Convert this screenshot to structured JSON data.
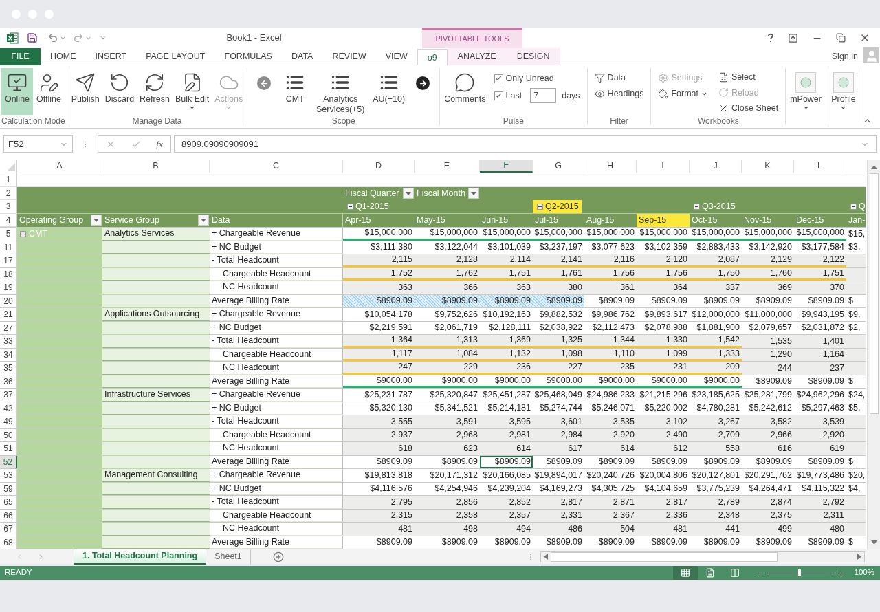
{
  "window": {
    "title": "Book1 - Excel",
    "context_group": "PIVOTTABLE TOOLS",
    "sign_in": "Sign in"
  },
  "ribbon_tabs": [
    {
      "label": "FILE",
      "kind": "file",
      "selected": false
    },
    {
      "label": "HOME",
      "kind": "standard",
      "selected": false
    },
    {
      "label": "INSERT",
      "kind": "standard",
      "selected": false
    },
    {
      "label": "PAGE LAYOUT",
      "kind": "standard",
      "selected": false
    },
    {
      "label": "FORMULAS",
      "kind": "standard",
      "selected": false
    },
    {
      "label": "DATA",
      "kind": "standard",
      "selected": false
    },
    {
      "label": "REVIEW",
      "kind": "standard",
      "selected": false
    },
    {
      "label": "VIEW",
      "kind": "standard",
      "selected": false
    },
    {
      "label": "o9",
      "kind": "standard",
      "selected": true
    },
    {
      "label": "ANALYZE",
      "kind": "contextual",
      "selected": false
    },
    {
      "label": "DESIGN",
      "kind": "contextual",
      "selected": false
    }
  ],
  "ribbon": {
    "groups": [
      {
        "label": "Calculation Mode",
        "items": [
          {
            "kind": "large",
            "label": "Online",
            "selected": true,
            "disabled": false,
            "dropdown": false
          },
          {
            "kind": "large",
            "label": "Offline",
            "selected": false,
            "disabled": false,
            "dropdown": false
          }
        ]
      },
      {
        "label": "Manage Data",
        "items": [
          {
            "kind": "large",
            "label": "Publish",
            "selected": false,
            "disabled": false,
            "dropdown": false
          },
          {
            "kind": "large",
            "label": "Discard",
            "selected": false,
            "disabled": false,
            "dropdown": false
          },
          {
            "kind": "large",
            "label": "Refresh",
            "selected": false,
            "disabled": false,
            "dropdown": false
          },
          {
            "kind": "large",
            "label": "Bulk Edit",
            "selected": false,
            "disabled": false,
            "dropdown": true
          },
          {
            "kind": "large",
            "label": "Actions",
            "selected": false,
            "disabled": true,
            "dropdown": true
          }
        ]
      },
      {
        "label": "Scope",
        "items": [
          {
            "kind": "nav",
            "disabled": true
          },
          {
            "kind": "large",
            "label": "CMT",
            "selected": false,
            "disabled": false,
            "dropdown": false
          },
          {
            "kind": "large",
            "label": "Analytics Services(+5)",
            "selected": false,
            "disabled": false,
            "dropdown": false
          },
          {
            "kind": "large",
            "label": "AU(+10)",
            "selected": false,
            "disabled": false,
            "dropdown": false
          },
          {
            "kind": "nav",
            "disabled": false
          }
        ]
      },
      {
        "label": "Pulse",
        "items": [
          {
            "kind": "large",
            "label": "Comments",
            "selected": false,
            "disabled": false,
            "dropdown": false
          },
          {
            "kind": "stack",
            "items": [
              {
                "kind": "check",
                "label": "Only Unread",
                "checked": true
              },
              {
                "kind": "check",
                "label": "Last",
                "checked": true,
                "input_value": "7",
                "unit": "days"
              }
            ]
          }
        ]
      },
      {
        "label": "Filter",
        "items": [
          {
            "kind": "stack",
            "items": [
              {
                "kind": "small",
                "label": "Data",
                "disabled": false,
                "dropdown": false
              },
              {
                "kind": "small",
                "label": "Headings",
                "disabled": false,
                "dropdown": false
              }
            ]
          }
        ]
      },
      {
        "label": "Workbooks",
        "items": [
          {
            "kind": "stack",
            "items": [
              {
                "kind": "small",
                "label": "Settings",
                "disabled": true,
                "dropdown": false
              },
              {
                "kind": "small",
                "label": "Format",
                "disabled": false,
                "dropdown": true
              }
            ]
          },
          {
            "kind": "stack",
            "items": [
              {
                "kind": "small",
                "label": "Select",
                "disabled": false,
                "dropdown": false
              },
              {
                "kind": "small",
                "label": "Reload",
                "disabled": true,
                "dropdown": false
              },
              {
                "kind": "small",
                "label": "Close Sheet",
                "disabled": false,
                "dropdown": false
              }
            ]
          }
        ]
      },
      {
        "items": [
          {
            "kind": "large",
            "label": "mPower",
            "selected": false,
            "disabled": false,
            "dropdown": true
          }
        ]
      },
      {
        "items": [
          {
            "kind": "large",
            "label": "Profile",
            "selected": false,
            "disabled": false,
            "dropdown": true
          }
        ]
      }
    ]
  },
  "formula_bar": {
    "name_box": "F52",
    "function_label": "fx",
    "formula": "8909.09090909091"
  },
  "grid": {
    "columns": [
      {
        "letter": "A",
        "selected": false
      },
      {
        "letter": "B",
        "selected": false
      },
      {
        "letter": "C",
        "selected": false
      },
      {
        "letter": "D",
        "selected": false
      },
      {
        "letter": "E",
        "selected": false
      },
      {
        "letter": "F",
        "selected": true
      },
      {
        "letter": "G",
        "selected": false
      },
      {
        "letter": "H",
        "selected": false
      },
      {
        "letter": "I",
        "selected": false
      },
      {
        "letter": "J",
        "selected": false
      },
      {
        "letter": "K",
        "selected": false
      },
      {
        "letter": "L",
        "selected": false
      }
    ],
    "header_row_numbers": [
      "1",
      "2",
      "3",
      "4"
    ],
    "column_fields": [
      {
        "label": "Fiscal Quarter",
        "filter": true
      },
      {
        "label": "Fiscal Month",
        "filter": true
      }
    ],
    "quarters": [
      {
        "label": "Q1-2015",
        "expanded": true,
        "selected": false,
        "months": [
          {
            "label": "Apr-15",
            "selected": false
          },
          {
            "label": "May-15",
            "selected": false
          },
          {
            "label": "Jun-15",
            "selected": false
          }
        ]
      },
      {
        "label": "Q2-2015",
        "expanded": true,
        "selected": true,
        "months": [
          {
            "label": "Jul-15",
            "selected": false
          },
          {
            "label": "Aug-15",
            "selected": false
          },
          {
            "label": "Sep-15",
            "selected": true
          }
        ]
      },
      {
        "label": "Q3-2015",
        "expanded": true,
        "selected": false,
        "months": [
          {
            "label": "Oct-15",
            "selected": false
          },
          {
            "label": "Nov-15",
            "selected": false
          },
          {
            "label": "Dec-15",
            "selected": false
          }
        ]
      },
      {
        "label": "Q",
        "expanded": true,
        "selected": false,
        "months": [
          {
            "label": "Jan-",
            "selected": false
          }
        ]
      }
    ],
    "row_fields": [
      {
        "label": "Operating Group",
        "filter": true
      },
      {
        "label": "Service Group",
        "filter": true
      },
      {
        "label": "Data",
        "filter": false
      }
    ],
    "rows": [
      {
        "number": "5",
        "selected": false,
        "kind": "currency",
        "operating_group": {
          "label": "CMT",
          "expanded": true
        },
        "service_group": "Analytics Services",
        "measure": "+ Chargeable Revenue",
        "values": [
          {
            "text": "$15,000,000",
            "color": "#22b36a"
          },
          {
            "text": "$15,000,000",
            "color": "#22b36a"
          },
          {
            "text": "$15,000,000",
            "color": "#22b36a"
          },
          {
            "text": "$15,000,000",
            "color": "#22b36a"
          },
          {
            "text": "$15,000,000",
            "color": "#22b36a"
          },
          {
            "text": "$15,000,000",
            "color": "#22b36a"
          },
          {
            "text": "$15,000,000",
            "color": "#22b36a"
          },
          {
            "text": "$15,000,000",
            "color": "#22b36a"
          },
          {
            "text": "$15,000,000",
            "color": "#22b36a"
          },
          "$15,"
        ]
      },
      {
        "number": "11",
        "selected": false,
        "kind": "currency",
        "measure": "+ NC Budget",
        "values": [
          "$3,111,380",
          "$3,122,044",
          "$3,101,039",
          "$3,237,197",
          "$3,077,623",
          "$3,102,359",
          "$2,883,433",
          "$3,142,920",
          "$3,177,584",
          "$3,"
        ]
      },
      {
        "number": "17",
        "selected": false,
        "kind": "headcount",
        "measure": "- Total Headcount",
        "values": [
          {
            "text": "2,115",
            "color": "#f7c42c"
          },
          {
            "text": "2,128",
            "color": "#f7c42c"
          },
          {
            "text": "2,114",
            "color": "#f7c42c"
          },
          {
            "text": "2,141",
            "color": "#f7c42c"
          },
          {
            "text": "2,116",
            "color": "#f7c42c"
          },
          {
            "text": "2,120",
            "color": "#f7c42c"
          },
          {
            "text": "2,087",
            "color": "#f7c42c"
          },
          {
            "text": "2,129",
            "color": "#f7c42c"
          },
          {
            "text": "2,122",
            "color": "#f7c42c"
          }
        ]
      },
      {
        "number": "18",
        "selected": false,
        "kind": "headcount-detail",
        "measure": "Chargeable Headcount",
        "values": [
          {
            "text": "1,752",
            "color": "#f7c42c"
          },
          {
            "text": "1,762",
            "color": "#f7c42c"
          },
          {
            "text": "1,751",
            "color": "#f7c42c"
          },
          {
            "text": "1,761",
            "color": "#f7c42c"
          },
          {
            "text": "1,756",
            "color": "#f7c42c"
          },
          {
            "text": "1,756",
            "color": "#f7c42c"
          },
          {
            "text": "1,750",
            "color": "#f7c42c"
          },
          {
            "text": "1,760",
            "color": "#f7c42c"
          },
          {
            "text": "1,751",
            "color": "#f7c42c"
          }
        ]
      },
      {
        "number": "19",
        "selected": false,
        "kind": "headcount-detail",
        "measure": "NC Headcount",
        "values": [
          "363",
          "366",
          "363",
          "380",
          "361",
          "364",
          "337",
          "369",
          "370"
        ]
      },
      {
        "number": "20",
        "selected": false,
        "kind": "currency",
        "measure": "Average Billing Rate",
        "values": [
          {
            "text": "$8909.09",
            "selected": true
          },
          {
            "text": "$8909.09",
            "selected": true
          },
          {
            "text": "$8909.09",
            "selected": true
          },
          {
            "text": "$8909.09",
            "selected": true
          },
          "$8909.09",
          "$8909.09",
          "$8909.09",
          "$8909.09",
          "$8909.09",
          "$"
        ]
      },
      {
        "number": "21",
        "selected": false,
        "kind": "currency",
        "service_group": "Applications Outsourcing",
        "measure": "+ Chargeable Revenue",
        "values": [
          "$10,054,178",
          "$9,752,626",
          "$10,192,163",
          "$9,882,532",
          "$9,986,762",
          "$9,893,617",
          "$12,000,000",
          "$11,000,000",
          "$9,943,195",
          "$9,"
        ]
      },
      {
        "number": "27",
        "selected": false,
        "kind": "currency",
        "measure": "+ NC Budget",
        "values": [
          "$2,219,591",
          "$2,061,719",
          "$2,128,111",
          "$2,038,922",
          "$2,112,473",
          "$2,078,988",
          "$1,881,900",
          "$2,079,657",
          "$2,031,872",
          "$2,"
        ]
      },
      {
        "number": "33",
        "selected": false,
        "kind": "headcount",
        "measure": "- Total Headcount",
        "values": [
          {
            "text": "1,364",
            "color": "#f7c42c"
          },
          {
            "text": "1,313",
            "color": "#f7c42c"
          },
          {
            "text": "1,369",
            "color": "#f7c42c"
          },
          {
            "text": "1,325",
            "color": "#f7c42c"
          },
          {
            "text": "1,344",
            "color": "#f7c42c"
          },
          {
            "text": "1,330",
            "color": "#f7c42c"
          },
          {
            "text": "1,542",
            "color": "#f7c42c"
          },
          "1,535",
          "1,401"
        ]
      },
      {
        "number": "34",
        "selected": false,
        "kind": "headcount-detail",
        "measure": "Chargeable Headcount",
        "values": [
          {
            "text": "1,117",
            "color": "#f7c42c"
          },
          {
            "text": "1,084",
            "color": "#f7c42c"
          },
          {
            "text": "1,132",
            "color": "#f7c42c"
          },
          {
            "text": "1,098",
            "color": "#f7c42c"
          },
          {
            "text": "1,110",
            "color": "#f7c42c"
          },
          {
            "text": "1,099",
            "color": "#f7c42c"
          },
          {
            "text": "1,333",
            "color": "#f7c42c"
          },
          "1,290",
          "1,164"
        ]
      },
      {
        "number": "35",
        "selected": false,
        "kind": "headcount-detail",
        "measure": "NC Headcount",
        "values": [
          {
            "text": "247",
            "color": "#f7c42c"
          },
          {
            "text": "229",
            "color": "#f7c42c"
          },
          {
            "text": "236",
            "color": "#f7c42c"
          },
          {
            "text": "227",
            "color": "#f7c42c"
          },
          {
            "text": "235",
            "color": "#f7c42c"
          },
          {
            "text": "231",
            "color": "#f7c42c"
          },
          {
            "text": "209",
            "color": "#f7c42c"
          },
          "244",
          "237"
        ]
      },
      {
        "number": "36",
        "selected": false,
        "kind": "currency",
        "measure": "Average Billing Rate",
        "values": [
          {
            "text": "$9000.00",
            "color": "#22b36a"
          },
          {
            "text": "$9000.00",
            "color": "#22b36a"
          },
          {
            "text": "$9000.00",
            "color": "#22b36a"
          },
          {
            "text": "$9000.00",
            "color": "#22b36a"
          },
          {
            "text": "$9000.00",
            "color": "#22b36a"
          },
          {
            "text": "$9000.00",
            "color": "#22b36a"
          },
          {
            "text": "$9000.00",
            "color": "#22b36a"
          },
          "$8909.09",
          "$8909.09",
          "$"
        ]
      },
      {
        "number": "37",
        "selected": false,
        "kind": "currency",
        "service_group": "Infrastructure Services",
        "measure": "+ Chargeable Revenue",
        "values": [
          "$25,231,787",
          "$25,320,847",
          "$25,451,287",
          "$25,468,049",
          "$24,986,233",
          "$21,215,296",
          "$23,185,625",
          "$25,281,799",
          "$24,962,296",
          "$24,"
        ]
      },
      {
        "number": "43",
        "selected": false,
        "kind": "currency",
        "measure": "+ NC Budget",
        "values": [
          "$5,320,130",
          "$5,341,521",
          "$5,214,181",
          "$5,274,744",
          "$5,246,071",
          "$5,220,002",
          "$4,780,281",
          "$5,242,612",
          "$5,297,463",
          "$5,"
        ]
      },
      {
        "number": "49",
        "selected": false,
        "kind": "headcount",
        "measure": "- Total Headcount",
        "values": [
          "3,555",
          "3,591",
          "3,595",
          "3,601",
          "3,535",
          "3,102",
          "3,267",
          "3,582",
          "3,539"
        ]
      },
      {
        "number": "50",
        "selected": false,
        "kind": "headcount-detail",
        "measure": "Chargeable Headcount",
        "values": [
          "2,937",
          "2,968",
          "2,981",
          "2,984",
          "2,920",
          "2,490",
          "2,709",
          "2,966",
          "2,920"
        ]
      },
      {
        "number": "51",
        "selected": false,
        "kind": "headcount-detail",
        "measure": "NC Headcount",
        "values": [
          "618",
          "623",
          "614",
          "617",
          "614",
          "612",
          "558",
          "616",
          "619"
        ]
      },
      {
        "number": "52",
        "selected": true,
        "kind": "currency",
        "measure": "Average Billing Rate",
        "values": [
          "$8909.09",
          "$8909.09",
          "$8909.09",
          "$8909.09",
          "$8909.09",
          "$8909.09",
          "$8909.09",
          "$8909.09",
          "$8909.09",
          "$"
        ]
      },
      {
        "number": "53",
        "selected": false,
        "kind": "currency",
        "service_group": "Management Consulting",
        "measure": "+ Chargeable Revenue",
        "values": [
          "$19,813,818",
          "$20,171,312",
          "$20,166,085",
          "$19,894,017",
          "$20,240,726",
          "$20,004,806",
          "$20,127,801",
          "$20,291,762",
          "$19,773,486",
          "$20,"
        ]
      },
      {
        "number": "59",
        "selected": false,
        "kind": "currency",
        "measure": "+ NC Budget",
        "values": [
          "$4,116,576",
          "$4,254,946",
          "$4,239,204",
          "$4,169,273",
          "$4,305,725",
          "$4,104,659",
          "$3,775,239",
          "$4,264,471",
          "$4,115,322",
          "$4,"
        ]
      },
      {
        "number": "65",
        "selected": false,
        "kind": "headcount",
        "measure": "- Total Headcount",
        "values": [
          "2,795",
          "2,856",
          "2,852",
          "2,817",
          "2,871",
          "2,817",
          "2,789",
          "2,874",
          "2,792"
        ]
      },
      {
        "number": "66",
        "selected": false,
        "kind": "headcount-detail",
        "measure": "Chargeable Headcount",
        "values": [
          "2,315",
          "2,358",
          "2,357",
          "2,331",
          "2,367",
          "2,336",
          "2,348",
          "2,375",
          "2,311"
        ]
      },
      {
        "number": "67",
        "selected": false,
        "kind": "headcount-detail",
        "measure": "NC Headcount",
        "values": [
          "481",
          "498",
          "494",
          "486",
          "504",
          "481",
          "441",
          "499",
          "480"
        ]
      },
      {
        "number": "68",
        "selected": false,
        "kind": "currency",
        "measure": "Average Billing Rate",
        "values": [
          "$8909.09",
          "$8909.09",
          "$8909.09",
          "$8909.09",
          "$8909.09",
          "$8909.09",
          "$8909.09",
          "$8909.09",
          "$8909.09",
          "$"
        ]
      }
    ]
  },
  "sheet_tabs": [
    {
      "label": "1. Total Headcount Planning",
      "selected": true
    },
    {
      "label": "Sheet1",
      "selected": false
    }
  ],
  "status_bar": {
    "mode": "READY",
    "views": [
      {
        "selected": true
      },
      {
        "selected": false
      },
      {
        "selected": false
      }
    ],
    "zoom": {
      "level": 0.49
    },
    "zoom_label": "100%"
  }
}
